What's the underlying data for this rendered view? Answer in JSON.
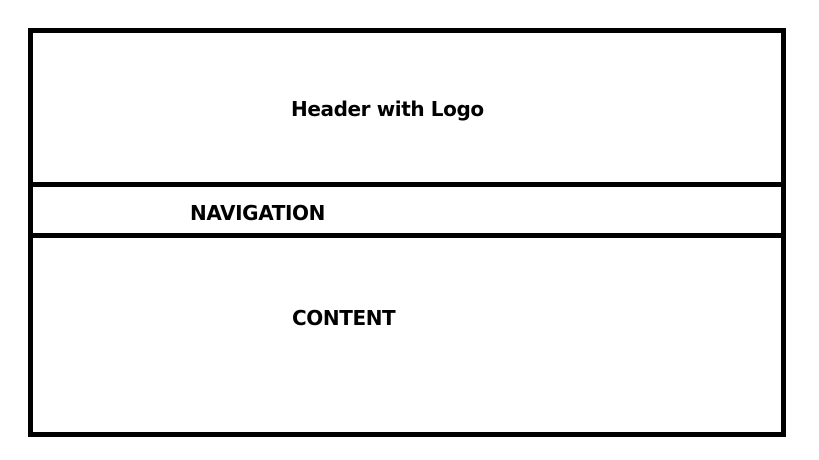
{
  "header": {
    "label": "Header with Logo"
  },
  "navigation": {
    "label": "NAVIGATION"
  },
  "content": {
    "label": "CONTENT"
  },
  "colors": {
    "border": "#000000",
    "background": "#ffffff",
    "text": "#000000"
  }
}
